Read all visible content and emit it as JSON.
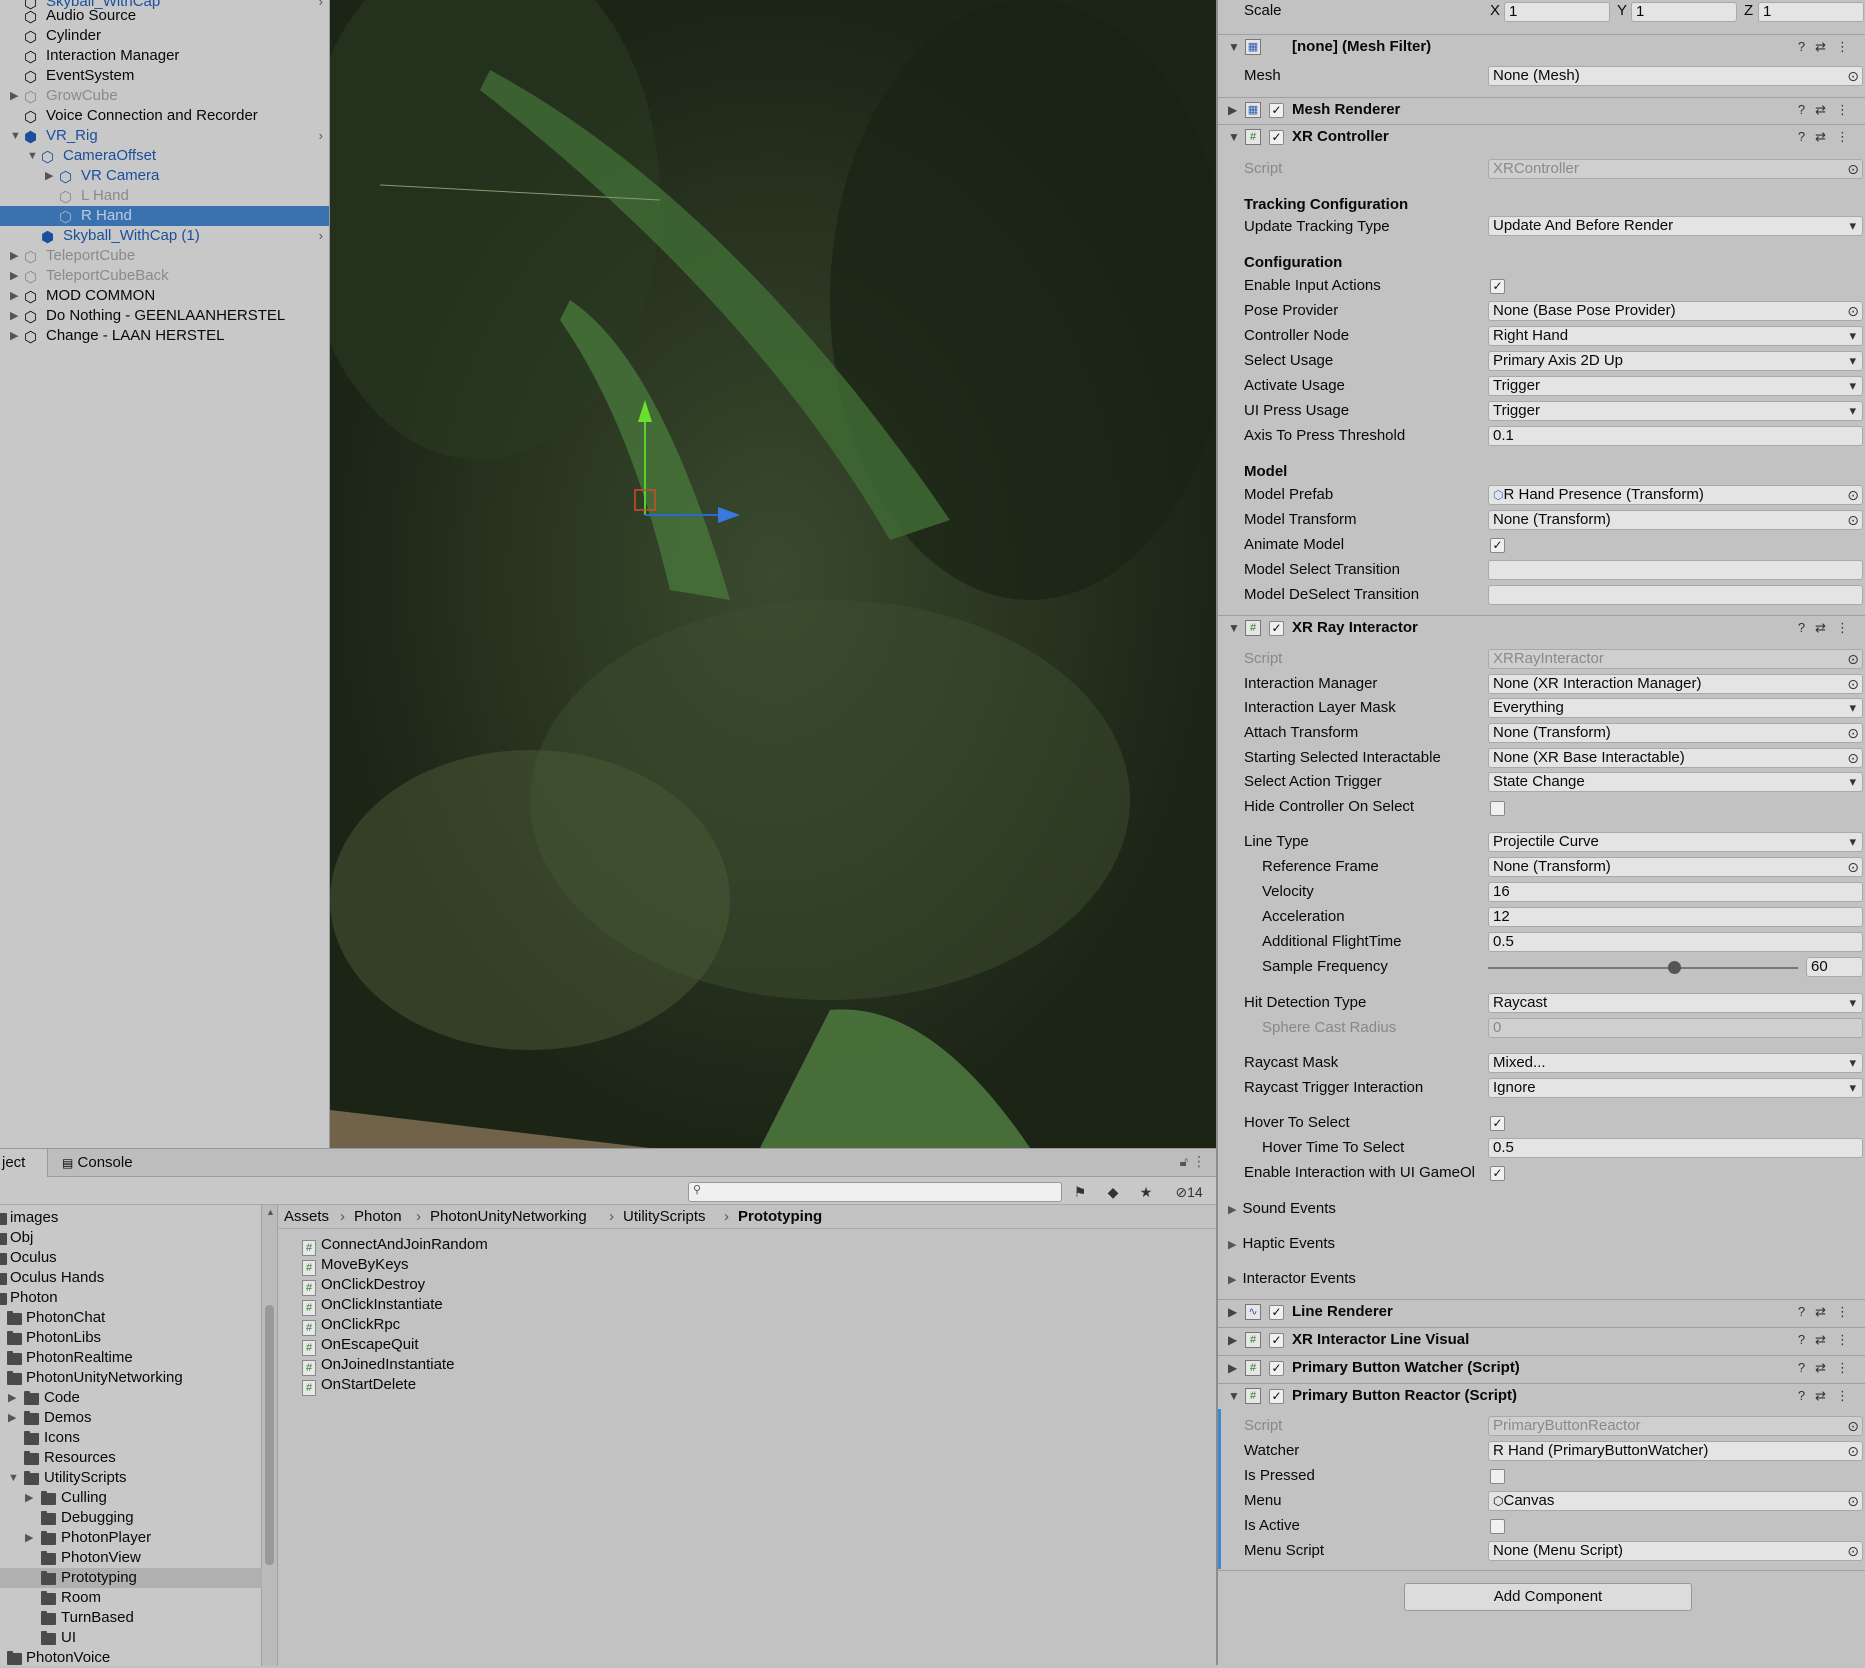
{
  "hierarchy": {
    "items": [
      {
        "label": "Skyball_WithCap",
        "style": "blue",
        "indent": 1,
        "top_cut": true
      },
      {
        "label": "Audio Source",
        "style": ""
      },
      {
        "label": "Cylinder",
        "style": ""
      },
      {
        "label": "Interaction Manager",
        "style": ""
      },
      {
        "label": "EventSystem",
        "style": ""
      },
      {
        "label": "GrowCube",
        "style": "grey"
      },
      {
        "label": "Voice Connection and Recorder",
        "style": ""
      },
      {
        "label": "VR_Rig",
        "style": "blue"
      },
      {
        "label": "CameraOffset",
        "style": "blue"
      },
      {
        "label": "VR Camera",
        "style": "blue"
      },
      {
        "label": "L Hand",
        "style": "grey"
      },
      {
        "label": "R Hand",
        "style": "selected"
      },
      {
        "label": "Skyball_WithCap (1)",
        "style": "blue"
      },
      {
        "label": "TeleportCube",
        "style": "grey"
      },
      {
        "label": "TeleportCubeBack",
        "style": "grey"
      },
      {
        "label": "MOD COMMON",
        "style": ""
      },
      {
        "label": "Do Nothing - GEENLAANHERSTEL",
        "style": ""
      },
      {
        "label": "Change - LAAN HERSTEL",
        "style": ""
      }
    ]
  },
  "project": {
    "tabs": [
      "ject",
      "Console"
    ],
    "hidden_count": "14",
    "tree": [
      "images",
      "Obj",
      "Oculus",
      "Oculus Hands",
      "Photon",
      "PhotonChat",
      "PhotonLibs",
      "PhotonRealtime",
      "PhotonUnityNetworking",
      "Code",
      "Demos",
      "Icons",
      "Resources",
      "UtilityScripts",
      "Culling",
      "Debugging",
      "PhotonPlayer",
      "PhotonView",
      "Prototyping",
      "Room",
      "TurnBased",
      "UI",
      "PhotonVoice"
    ],
    "breadcrumb": [
      "Assets",
      "Photon",
      "PhotonUnityNetworking",
      "UtilityScripts",
      "Prototyping"
    ],
    "files": [
      "ConnectAndJoinRandom",
      "MoveByKeys",
      "OnClickDestroy",
      "OnClickInstantiate",
      "OnClickRpc",
      "OnEscapeQuit",
      "OnJoinedInstantiate",
      "OnStartDelete"
    ]
  },
  "inspector": {
    "scale": {
      "label": "Scale",
      "x_label": "X",
      "x": "1",
      "y_label": "Y",
      "y": "1",
      "z_label": "Z",
      "z": "1"
    },
    "mesh_filter": {
      "title": "[none] (Mesh Filter)",
      "mesh_label": "Mesh",
      "mesh_value": "None (Mesh)"
    },
    "mesh_renderer": {
      "title": "Mesh Renderer"
    },
    "xr_controller": {
      "title": "XR Controller",
      "script_label": "Script",
      "script_value": "XRController",
      "tracking_section": "Tracking Configuration",
      "update_tracking_label": "Update Tracking Type",
      "update_tracking_value": "Update And Before Render",
      "config_section": "Configuration",
      "enable_input_label": "Enable Input Actions",
      "pose_label": "Pose Provider",
      "pose_value": "None (Base Pose Provider)",
      "node_label": "Controller Node",
      "node_value": "Right Hand",
      "select_usage_label": "Select Usage",
      "select_usage_value": "Primary Axis 2D Up",
      "activate_usage_label": "Activate Usage",
      "activate_usage_value": "Trigger",
      "ui_press_label": "UI Press Usage",
      "ui_press_value": "Trigger",
      "axis_label": "Axis To Press Threshold",
      "axis_value": "0.1",
      "model_section": "Model",
      "model_prefab_label": "Model Prefab",
      "model_prefab_value": "R Hand Presence (Transform)",
      "model_transform_label": "Model Transform",
      "model_transform_value": "None (Transform)",
      "animate_label": "Animate Model",
      "select_trans_label": "Model Select Transition",
      "select_trans_value": "",
      "deselect_trans_label": "Model DeSelect Transition",
      "deselect_trans_value": ""
    },
    "ray": {
      "title": "XR Ray Interactor",
      "script_label": "Script",
      "script_value": "XRRayInteractor",
      "im_label": "Interaction Manager",
      "im_value": "None (XR Interaction Manager)",
      "mask_label": "Interaction Layer Mask",
      "mask_value": "Everything",
      "attach_label": "Attach Transform",
      "attach_value": "None (Transform)",
      "start_sel_label": "Starting Selected Interactable",
      "start_sel_value": "None (XR Base Interactable)",
      "trigger_label": "Select Action Trigger",
      "trigger_value": "State Change",
      "hide_label": "Hide Controller On Select",
      "line_type_label": "Line Type",
      "line_type_value": "Projectile Curve",
      "ref_frame_label": "Reference Frame",
      "ref_frame_value": "None (Transform)",
      "velocity_label": "Velocity",
      "velocity_value": "16",
      "accel_label": "Acceleration",
      "accel_value": "12",
      "flight_label": "Additional FlightTime",
      "flight_value": "0.5",
      "freq_label": "Sample Frequency",
      "freq_value": "60",
      "freq_fraction": 0.6,
      "hit_label": "Hit Detection Type",
      "hit_value": "Raycast",
      "sphere_label": "Sphere Cast Radius",
      "sphere_value": "0",
      "raymask_label": "Raycast Mask",
      "raymask_value": "Mixed...",
      "raytrig_label": "Raycast Trigger Interaction",
      "raytrig_value": "Ignore",
      "hover_label": "Hover To Select",
      "hover_time_label": "Hover Time To Select",
      "hover_time_value": "0.5",
      "ui_label": "Enable Interaction with UI GameOl",
      "sound_label": "Sound Events",
      "haptic_label": "Haptic Events",
      "interactor_label": "Interactor Events"
    },
    "line_renderer": {
      "title": "Line Renderer"
    },
    "line_visual": {
      "title": "XR Interactor Line Visual"
    },
    "watcher": {
      "title": "Primary Button Watcher (Script)"
    },
    "reactor": {
      "title": "Primary Button Reactor (Script)",
      "script_label": "Script",
      "script_value": "PrimaryButtonReactor",
      "watcher_label": "Watcher",
      "watcher_value": "R Hand (PrimaryButtonWatcher)",
      "pressed_label": "Is Pressed",
      "menu_label": "Menu",
      "menu_value": "Canvas",
      "active_label": "Is Active",
      "menu_script_label": "Menu Script",
      "menu_script_value": "None (Menu Script)"
    },
    "add_component": "Add Component"
  },
  "colors": {
    "selection": "#3a72b0",
    "panel": "#c2c2c2",
    "accent_blue": "#1a4f9c"
  }
}
